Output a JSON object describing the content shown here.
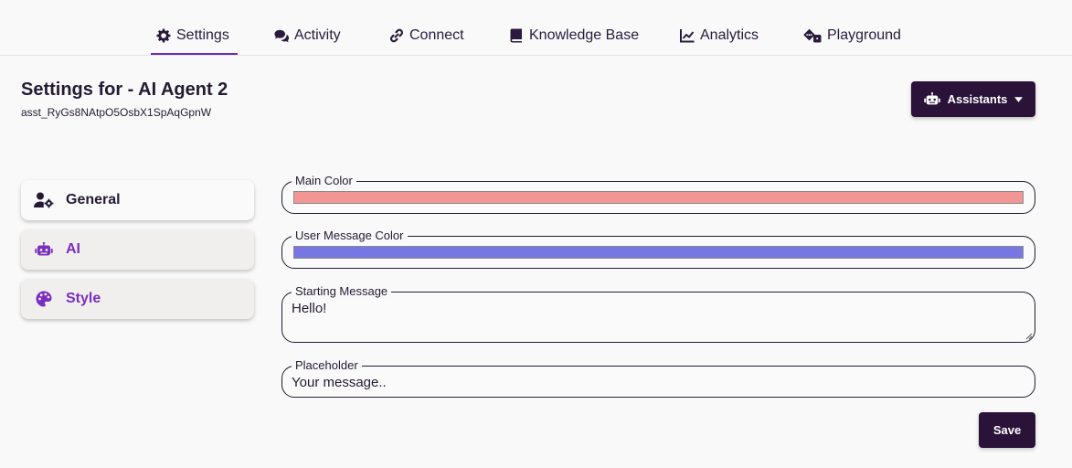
{
  "nav": {
    "tabs": [
      {
        "label": "Settings",
        "icon": "gear-icon",
        "active": true
      },
      {
        "label": "Activity",
        "icon": "comments-icon"
      },
      {
        "label": "Connect",
        "icon": "link-icon"
      },
      {
        "label": "Knowledge Base",
        "icon": "book-icon"
      },
      {
        "label": "Analytics",
        "icon": "chart-line-icon"
      },
      {
        "label": "Playground",
        "icon": "dice-icon"
      }
    ]
  },
  "header": {
    "title": "Settings for - AI Agent 2",
    "assistant_id": "asst_RyGs8NAtpO5OsbX1SpAqGpnW",
    "assistants_button": "Assistants"
  },
  "sidebar": {
    "items": [
      {
        "label": "General",
        "icon": "user-gear-icon",
        "active": true
      },
      {
        "label": "AI",
        "icon": "robot-icon"
      },
      {
        "label": "Style",
        "icon": "palette-icon"
      }
    ]
  },
  "form": {
    "main_color": {
      "label": "Main Color",
      "value": "#f19595"
    },
    "user_message_color": {
      "label": "User Message Color",
      "value": "#7777e3"
    },
    "starting_message": {
      "label": "Starting Message",
      "value": "Hello!"
    },
    "placeholder": {
      "label": "Placeholder",
      "value": "Your message.."
    },
    "save_label": "Save"
  },
  "colors": {
    "primary_dark": "#2a1239",
    "accent_purple": "#7a2fc0",
    "tab_underline": "#6a2fb0"
  }
}
